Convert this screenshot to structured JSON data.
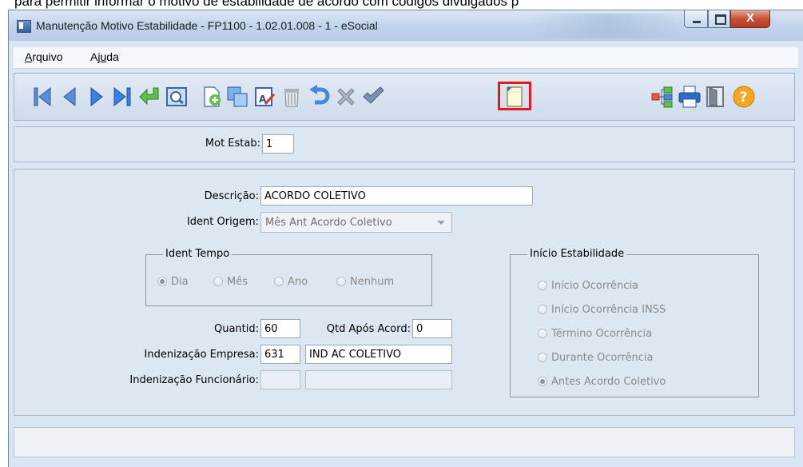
{
  "background_text": "para permitir informar o motivo de estabilidade de acordo com códigos divulgados p",
  "window": {
    "title": "Manutenção Motivo Estabilidade - FP1100 - 1.02.01.008 - 1 - eSocial",
    "close_glyph": "X"
  },
  "menu": {
    "arquivo_first": "A",
    "arquivo_rest": "rquivo",
    "ajuda_first": "Aj",
    "ajuda_u": "u",
    "ajuda_rest": "da"
  },
  "toolbar": {
    "buttons": [
      "first-record-icon",
      "previous-record-icon",
      "next-record-icon",
      "last-record-icon",
      "go-to-icon",
      "search-icon",
      "new-icon",
      "copy-icon",
      "edit-icon",
      "delete-icon",
      "undo-icon",
      "cancel-icon",
      "save-icon",
      "note-icon",
      "tree-icon",
      "print-icon",
      "exit-icon",
      "help-icon"
    ],
    "highlight_color": "#e01b1b"
  },
  "key": {
    "label": "Mot Estab:",
    "value": "1"
  },
  "form": {
    "descricao_label": "Descrição:",
    "descricao_value": "ACORDO COLETIVO",
    "ident_origem_label": "Ident Origem:",
    "ident_origem_value": "Mês Ant Acordo Coletivo",
    "ident_tempo": {
      "legend": "Ident Tempo",
      "options": [
        "Dia",
        "Mês",
        "Ano",
        "Nenhum"
      ],
      "selected": "Dia"
    },
    "quantid_label": "Quantid:",
    "quantid_value": "60",
    "qtd_apos_label": "Qtd Após Acord:",
    "qtd_apos_value": "0",
    "inden_empresa_label": "Indenização Empresa:",
    "inden_empresa_code": "631",
    "inden_empresa_desc": "IND AC COLETIVO",
    "inden_func_label": "Indenização Funcionário:",
    "inden_func_code": "",
    "inden_func_desc": "",
    "inicio_estabilidade": {
      "legend": "Início Estabilidade",
      "options": [
        "Início Ocorrência",
        "Início Ocorrência INSS",
        "Término Ocorrência",
        "Durante Ocorrência",
        "Antes Acordo Coletivo"
      ],
      "selected": "Antes Acordo Coletivo"
    }
  }
}
